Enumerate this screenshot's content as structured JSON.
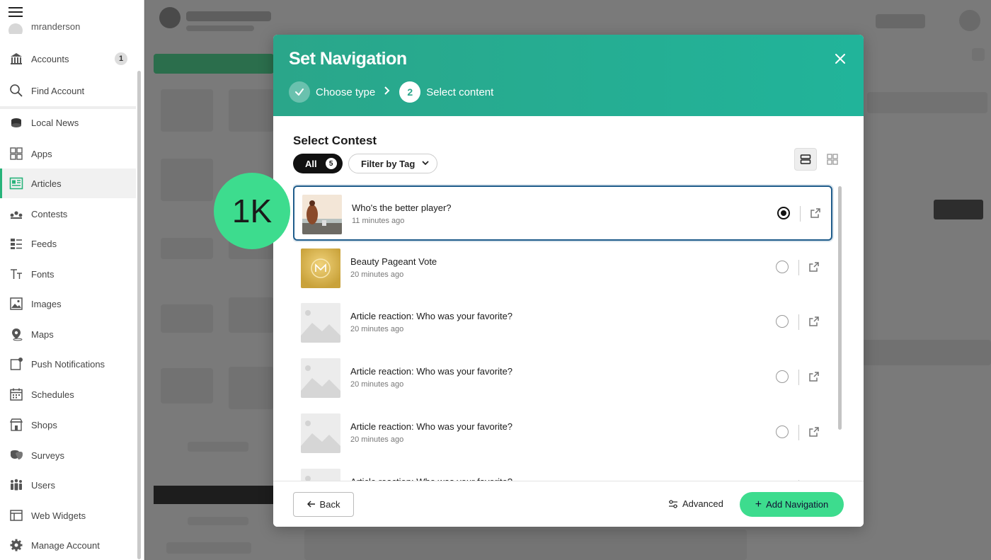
{
  "sidebar": {
    "username": "mranderson",
    "items": [
      {
        "label": "Accounts",
        "icon": "bank-icon",
        "count": "1"
      },
      {
        "label": "Find Account",
        "icon": "search-icon"
      },
      {
        "label": "Local News",
        "icon": "news-icon"
      },
      {
        "label": "Apps",
        "icon": "apps-grid-icon"
      },
      {
        "label": "Articles",
        "icon": "article-icon",
        "active": true
      },
      {
        "label": "Contests",
        "icon": "contest-icon"
      },
      {
        "label": "Feeds",
        "icon": "feed-icon"
      },
      {
        "label": "Fonts",
        "icon": "font-icon"
      },
      {
        "label": "Images",
        "icon": "image-icon"
      },
      {
        "label": "Maps",
        "icon": "map-pin-icon"
      },
      {
        "label": "Push Notifications",
        "icon": "notification-icon"
      },
      {
        "label": "Schedules",
        "icon": "calendar-icon"
      },
      {
        "label": "Shops",
        "icon": "shop-icon"
      },
      {
        "label": "Surveys",
        "icon": "survey-icon"
      },
      {
        "label": "Users",
        "icon": "users-icon"
      },
      {
        "label": "Web Widgets",
        "icon": "widget-icon"
      },
      {
        "label": "Manage Account",
        "icon": "gear-icon"
      }
    ]
  },
  "bubble": {
    "text": "1K"
  },
  "modal": {
    "title": "Set Navigation",
    "steps": [
      {
        "label": "Choose type",
        "state": "done"
      },
      {
        "label": "Select content",
        "number": "2",
        "state": "current"
      }
    ],
    "section_title": "Select Contest",
    "filter": {
      "all_label": "All",
      "all_count": "5",
      "tag_label": "Filter by Tag"
    },
    "items": [
      {
        "title": "Who's the better player?",
        "time": "11 minutes ago",
        "selected": true,
        "thumb": "photo"
      },
      {
        "title": "Beauty Pageant Vote",
        "time": "20 minutes ago",
        "selected": false,
        "thumb": "gold"
      },
      {
        "title": "Article reaction: Who was your favorite?",
        "time": "20 minutes ago",
        "selected": false,
        "thumb": "placeholder"
      },
      {
        "title": "Article reaction: Who was your favorite?",
        "time": "20 minutes ago",
        "selected": false,
        "thumb": "placeholder"
      },
      {
        "title": "Article reaction: Who was your favorite?",
        "time": "20 minutes ago",
        "selected": false,
        "thumb": "placeholder"
      },
      {
        "title": "Article reaction: Who was your favorite?",
        "time": "",
        "selected": false,
        "thumb": "placeholder"
      }
    ],
    "footer": {
      "back_label": "Back",
      "advanced_label": "Advanced",
      "add_label": "Add Navigation"
    }
  },
  "colors": {
    "accent": "#3ddc8e",
    "header": "#21b49a",
    "selected_border": "#1f5c8b"
  }
}
